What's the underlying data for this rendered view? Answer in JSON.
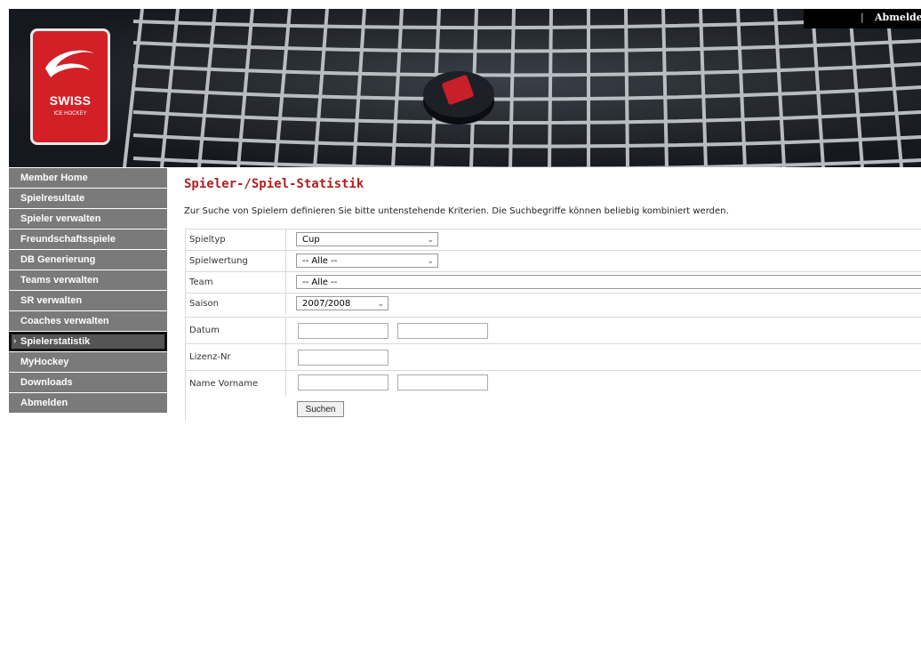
{
  "header": {
    "top_separator": "|",
    "top_logout": "Abmelden",
    "logo_text": "SWISS",
    "logo_subtext": "ICE HOCKEY"
  },
  "sidebar": {
    "items": [
      {
        "label": "Member Home"
      },
      {
        "label": "Spielresultate"
      },
      {
        "label": "Spieler verwalten"
      },
      {
        "label": "Freundschaftsspiele"
      },
      {
        "label": "DB Generierung"
      },
      {
        "label": "Teams verwalten"
      },
      {
        "label": "SR verwalten"
      },
      {
        "label": "Coaches verwalten"
      },
      {
        "label": "Spielerstatistik",
        "active": true
      },
      {
        "label": "MyHockey"
      },
      {
        "label": "Downloads"
      },
      {
        "label": "Abmelden"
      }
    ],
    "active_bullet": "›"
  },
  "main": {
    "title": "Spieler-/Spiel-Statistik",
    "intro": "Zur Suche von Spielern definieren Sie bitte untenstehende Kriterien. Die Suchbegriffe können beliebig kombiniert werden."
  },
  "form": {
    "spieltyp_label": "Spieltyp",
    "spieltyp_value": "Cup",
    "spielwertung_label": "Spielwertung",
    "spielwertung_value": "-- Alle --",
    "team_label": "Team",
    "team_value": "-- Alle --",
    "saison_label": "Saison",
    "saison_value": "2007/2008",
    "datum_label": "Datum",
    "datum_from": "",
    "datum_to": "",
    "lizenz_label": "Lizenz-Nr",
    "lizenz_value": "",
    "name_label": "Name Vorname",
    "name_value": "",
    "vorname_value": "",
    "submit_label": "Suchen",
    "dropdown_arrow": "⌄"
  },
  "colors": {
    "accent": "#b22022",
    "logo_red": "#d31f26",
    "nav_bg": "#7a7a7a"
  }
}
